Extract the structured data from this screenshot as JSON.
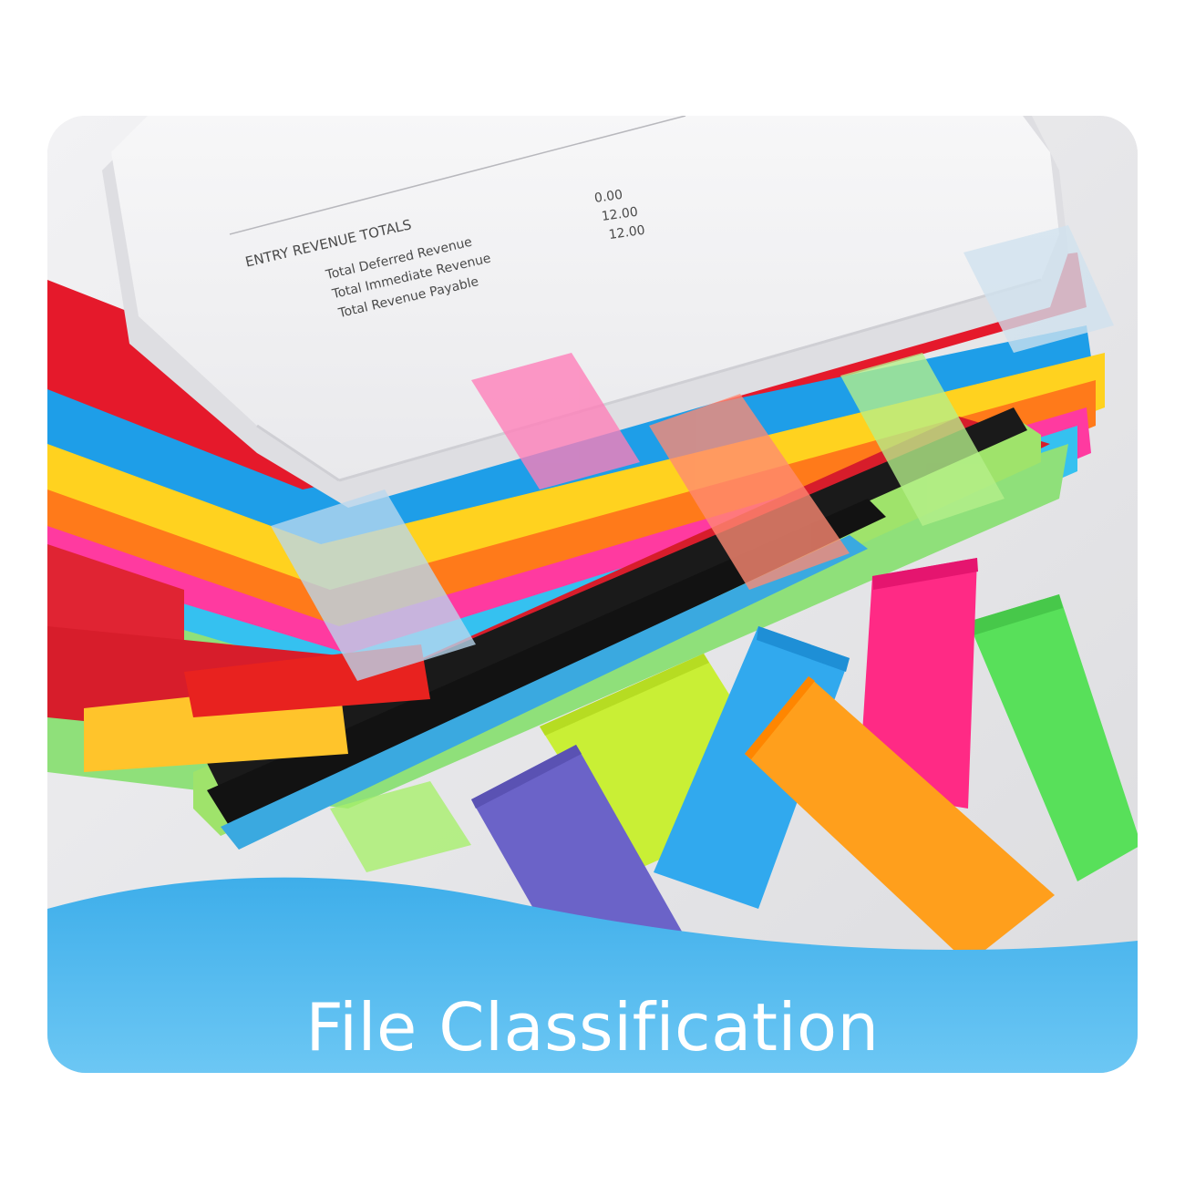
{
  "caption": "File Classification",
  "document": {
    "heading": "ENTRY REVENUE TOTALS",
    "rows": [
      {
        "label": "Total Deferred Revenue",
        "value": "0.00"
      },
      {
        "label": "Total Immediate Revenue",
        "value": "12.00"
      },
      {
        "label": "Total Revenue Payable",
        "value": "12.00"
      }
    ]
  },
  "colors": {
    "background": "#ececee",
    "wave": "#52b9ee",
    "sticky_tabs": [
      "#6b63c8",
      "#31a9ee",
      "#ff9f1c",
      "#ff2a85",
      "#5fe25a",
      "#c9ef35"
    ]
  }
}
